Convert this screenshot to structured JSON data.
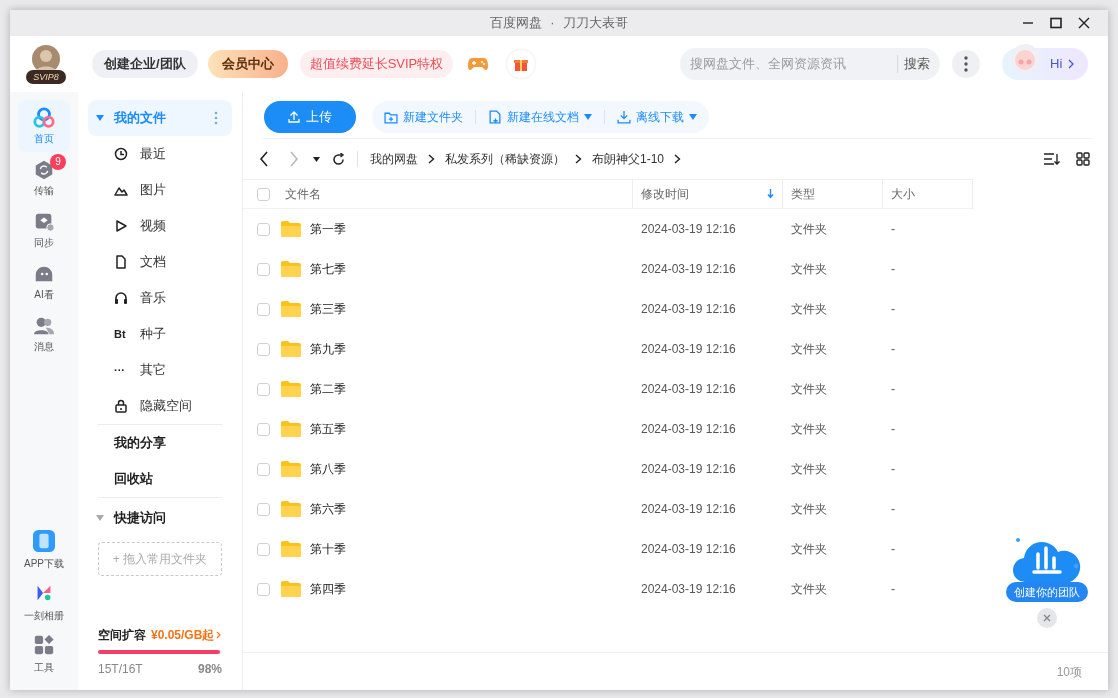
{
  "window": {
    "title_app": "百度网盘",
    "title_separator": "·",
    "title_user": "刀刀大表哥"
  },
  "header": {
    "vip_badge": "SVIP8",
    "team_button": "创建企业/团队",
    "member_button": "会员中心",
    "renew_button": "超值续费延长SVIP特权",
    "search": {
      "placeholder": "搜网盘文件、全网资源资讯",
      "button": "搜索"
    },
    "greeting": "Hi"
  },
  "nav_rail": [
    {
      "label": "首页",
      "kind": "home",
      "selected": true
    },
    {
      "label": "传输",
      "kind": "transfer",
      "badge": "9",
      "selected": false
    },
    {
      "label": "同步",
      "kind": "sync",
      "selected": false
    },
    {
      "label": "AI看",
      "kind": "ai",
      "selected": false
    },
    {
      "label": "消息",
      "kind": "people",
      "selected": false
    }
  ],
  "nav_rail_bottom": [
    {
      "label": "APP下载",
      "kind": "phone"
    },
    {
      "label": "一刻相册",
      "kind": "album"
    },
    {
      "label": "工具",
      "kind": "tools"
    }
  ],
  "sidebar": {
    "my_files": {
      "label": "我的文件",
      "expanded": true,
      "selected": true
    },
    "categories": [
      {
        "label": "最近",
        "kind": "clock"
      },
      {
        "label": "图片",
        "kind": "mountain"
      },
      {
        "label": "视频",
        "kind": "play"
      },
      {
        "label": "文档",
        "kind": "doc"
      },
      {
        "label": "音乐",
        "kind": "headphones"
      },
      {
        "label": "种子",
        "kind": "glyph",
        "glyph": "Bt"
      },
      {
        "label": "其它",
        "kind": "glyph",
        "glyph": "···"
      },
      {
        "label": "隐藏空间",
        "kind": "lock"
      }
    ],
    "links": [
      "我的分享",
      "回收站"
    ],
    "quick_access": {
      "label": "快捷访问",
      "expanded": true,
      "drop_zone": "+ 拖入常用文件夹"
    },
    "storage": {
      "label": "空间扩容",
      "price": "¥0.05/GB起",
      "usage": "15T/16T",
      "percent": "98%",
      "level": 0.98
    }
  },
  "toolbar": {
    "upload": "上传",
    "actions": [
      {
        "label": "新建文件夹",
        "kind": "folder-plus",
        "dropdown": false
      },
      {
        "label": "新建在线文档",
        "kind": "doc-plus",
        "dropdown": true
      },
      {
        "label": "离线下载",
        "kind": "download",
        "dropdown": true
      }
    ]
  },
  "breadcrumb": [
    "我的网盘",
    "私发系列（稀缺资源）",
    "布朗神父1-10"
  ],
  "table": {
    "columns": [
      {
        "label": "文件名",
        "sorted": false
      },
      {
        "label": "修改时间",
        "sorted": true
      },
      {
        "label": "类型",
        "sorted": false
      },
      {
        "label": "大小",
        "sorted": false
      }
    ],
    "rows": [
      {
        "name": "第一季",
        "modified": "2024-03-19 12:16",
        "type": "文件夹",
        "size": "-",
        "checked": false
      },
      {
        "name": "第七季",
        "modified": "2024-03-19 12:16",
        "type": "文件夹",
        "size": "-",
        "checked": false
      },
      {
        "name": "第三季",
        "modified": "2024-03-19 12:16",
        "type": "文件夹",
        "size": "-",
        "checked": false
      },
      {
        "name": "第九季",
        "modified": "2024-03-19 12:16",
        "type": "文件夹",
        "size": "-",
        "checked": false
      },
      {
        "name": "第二季",
        "modified": "2024-03-19 12:16",
        "type": "文件夹",
        "size": "-",
        "checked": false
      },
      {
        "name": "第五季",
        "modified": "2024-03-19 12:16",
        "type": "文件夹",
        "size": "-",
        "checked": false
      },
      {
        "name": "第八季",
        "modified": "2024-03-19 12:16",
        "type": "文件夹",
        "size": "-",
        "checked": false
      },
      {
        "name": "第六季",
        "modified": "2024-03-19 12:16",
        "type": "文件夹",
        "size": "-",
        "checked": false
      },
      {
        "name": "第十季",
        "modified": "2024-03-19 12:16",
        "type": "文件夹",
        "size": "-",
        "checked": false
      },
      {
        "name": "第四季",
        "modified": "2024-03-19 12:16",
        "type": "文件夹",
        "size": "-",
        "checked": false
      }
    ]
  },
  "promo": {
    "label": "创建你的团队"
  },
  "status_bar": {
    "count": "10项"
  }
}
